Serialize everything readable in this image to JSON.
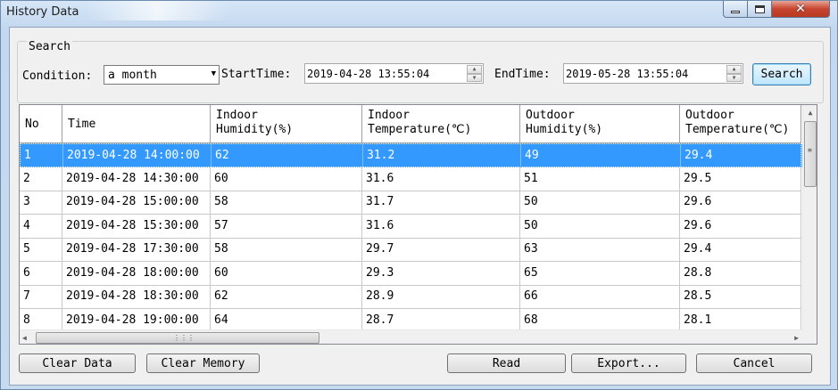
{
  "window": {
    "title": "History Data"
  },
  "search": {
    "group_label": "Search",
    "condition_label": "Condition:",
    "condition_value": "a month",
    "start_label": "StartTime:",
    "start_value": "2019-04-28 13:55:04",
    "end_label": "EndTime:",
    "end_value": "2019-05-28 13:55:04",
    "search_button": "Search"
  },
  "table": {
    "columns": [
      {
        "line1": "No",
        "line2": ""
      },
      {
        "line1": "Time",
        "line2": ""
      },
      {
        "line1": "Indoor",
        "line2": "Humidity(%)"
      },
      {
        "line1": "Indoor",
        "line2": "Temperature(℃)"
      },
      {
        "line1": "Outdoor",
        "line2": "Humidity(%)"
      },
      {
        "line1": "Outdoor",
        "line2": "Temperature(℃)"
      }
    ],
    "rows": [
      [
        "1",
        "2019-04-28 14:00:00",
        "62",
        "31.2",
        "49",
        "29.4"
      ],
      [
        "2",
        "2019-04-28 14:30:00",
        "60",
        "31.6",
        "51",
        "29.5"
      ],
      [
        "3",
        "2019-04-28 15:00:00",
        "58",
        "31.7",
        "50",
        "29.6"
      ],
      [
        "4",
        "2019-04-28 15:30:00",
        "57",
        "31.6",
        "50",
        "29.6"
      ],
      [
        "5",
        "2019-04-28 17:30:00",
        "58",
        "29.7",
        "63",
        "29.4"
      ],
      [
        "6",
        "2019-04-28 18:00:00",
        "60",
        "29.3",
        "65",
        "28.8"
      ],
      [
        "7",
        "2019-04-28 18:30:00",
        "62",
        "28.9",
        "66",
        "28.5"
      ],
      [
        "8",
        "2019-04-28 19:00:00",
        "64",
        "28.7",
        "68",
        "28.1"
      ]
    ],
    "selected_row": 0
  },
  "buttons": {
    "clear_data": "Clear Data",
    "clear_memory": "Clear Memory",
    "read": "Read",
    "export": "Export...",
    "cancel": "Cancel"
  },
  "colors": {
    "selection": "#3399ff",
    "close_button": "#c7442e"
  },
  "icons": [
    "minimize-icon",
    "maximize-icon",
    "close-icon",
    "dropdown-arrow-icon",
    "spin-up-icon",
    "spin-down-icon",
    "scroll-up-icon",
    "scroll-left-icon",
    "scroll-right-icon"
  ]
}
